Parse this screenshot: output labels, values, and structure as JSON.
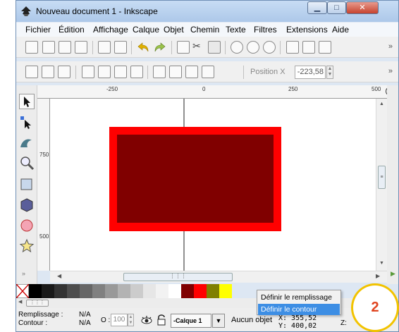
{
  "window": {
    "title": "Nouveau document 1 - Inkscape",
    "controls": {
      "minimize": "▁",
      "maximize": "□",
      "close": "✕"
    }
  },
  "menubar": {
    "items": [
      "Fichier",
      "Édition",
      "Affichage",
      "Calque",
      "Objet",
      "Chemin",
      "Texte",
      "Filtres",
      "Extensions",
      "Aide"
    ]
  },
  "toolbar2": {
    "position_label": "Position X",
    "position_value": "-223,58"
  },
  "rulers": {
    "top": [
      "-250",
      "0",
      "250",
      "500"
    ],
    "left": [
      "750",
      "500"
    ]
  },
  "palette": {
    "colors": [
      "#000000",
      "#1a1a1a",
      "#333333",
      "#4d4d4d",
      "#666666",
      "#808080",
      "#999999",
      "#b3b3b3",
      "#cccccc",
      "#e6e6e6",
      "#f2f2f2",
      "#ffffff",
      "#800000",
      "#ff0000",
      "#808000",
      "#ffff00"
    ]
  },
  "context_menu": {
    "items": [
      "Définir le remplissage",
      "Définir le contour"
    ],
    "highlighted_index": 1
  },
  "statusbar": {
    "fill_label": "Remplissage :",
    "fill_value": "N/A",
    "stroke_label": "Contour :",
    "stroke_value": "N/A",
    "opacity_label": "O :",
    "opacity_value": "100",
    "layer_name": "-Calque 1",
    "message": "Aucun objet",
    "x_coord": "X: 355,52",
    "y_coord": "Y:  400,02",
    "zoom_label": "Z:"
  },
  "step_badge": {
    "label": "2"
  },
  "colors": {
    "rect_outer": "#ff0000",
    "rect_inner": "#800000",
    "highlight": "#3d8ee4",
    "badge_border": "#f2c300",
    "badge_text": "#e0441f"
  }
}
